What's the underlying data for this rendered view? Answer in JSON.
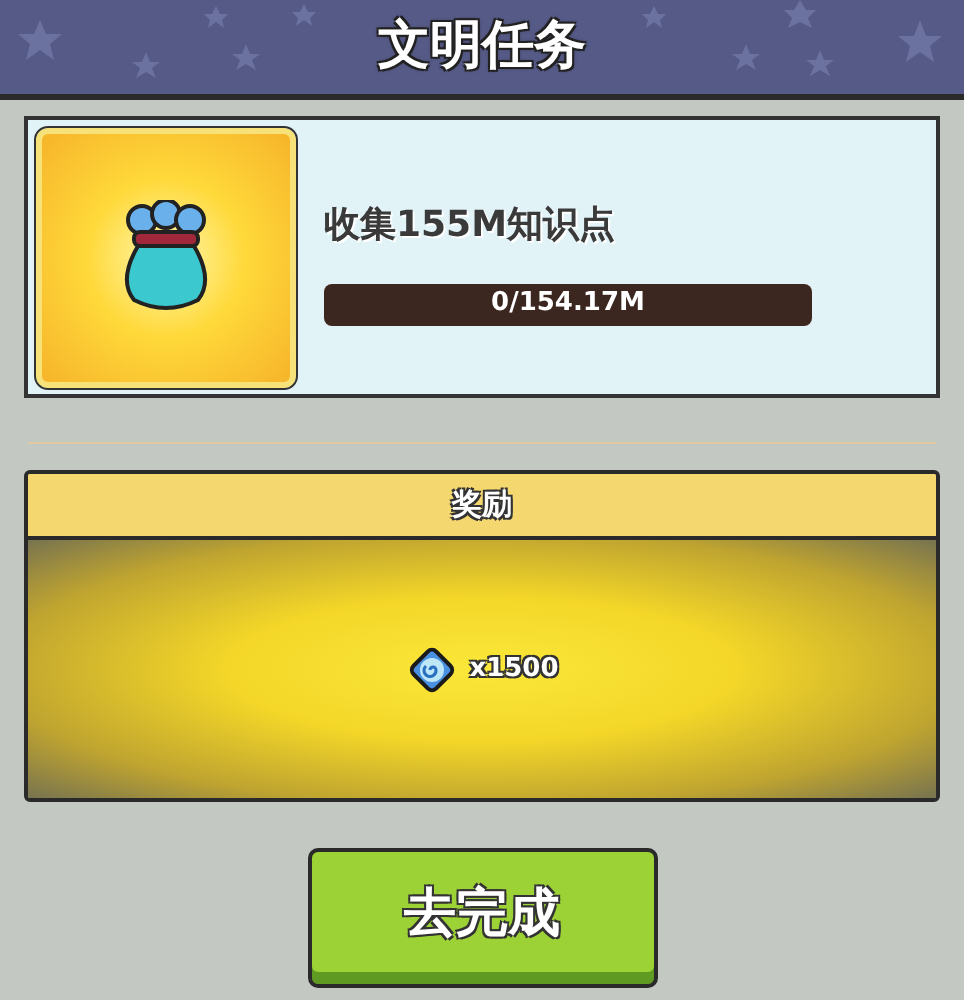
{
  "header": {
    "title": "文明任务"
  },
  "task": {
    "description": "收集155M知识点",
    "progress": {
      "level": 0,
      "reading": "0/154.17M"
    }
  },
  "reward": {
    "heading": "奖励",
    "amount": "x1500"
  },
  "button": {
    "label": "去完成"
  }
}
